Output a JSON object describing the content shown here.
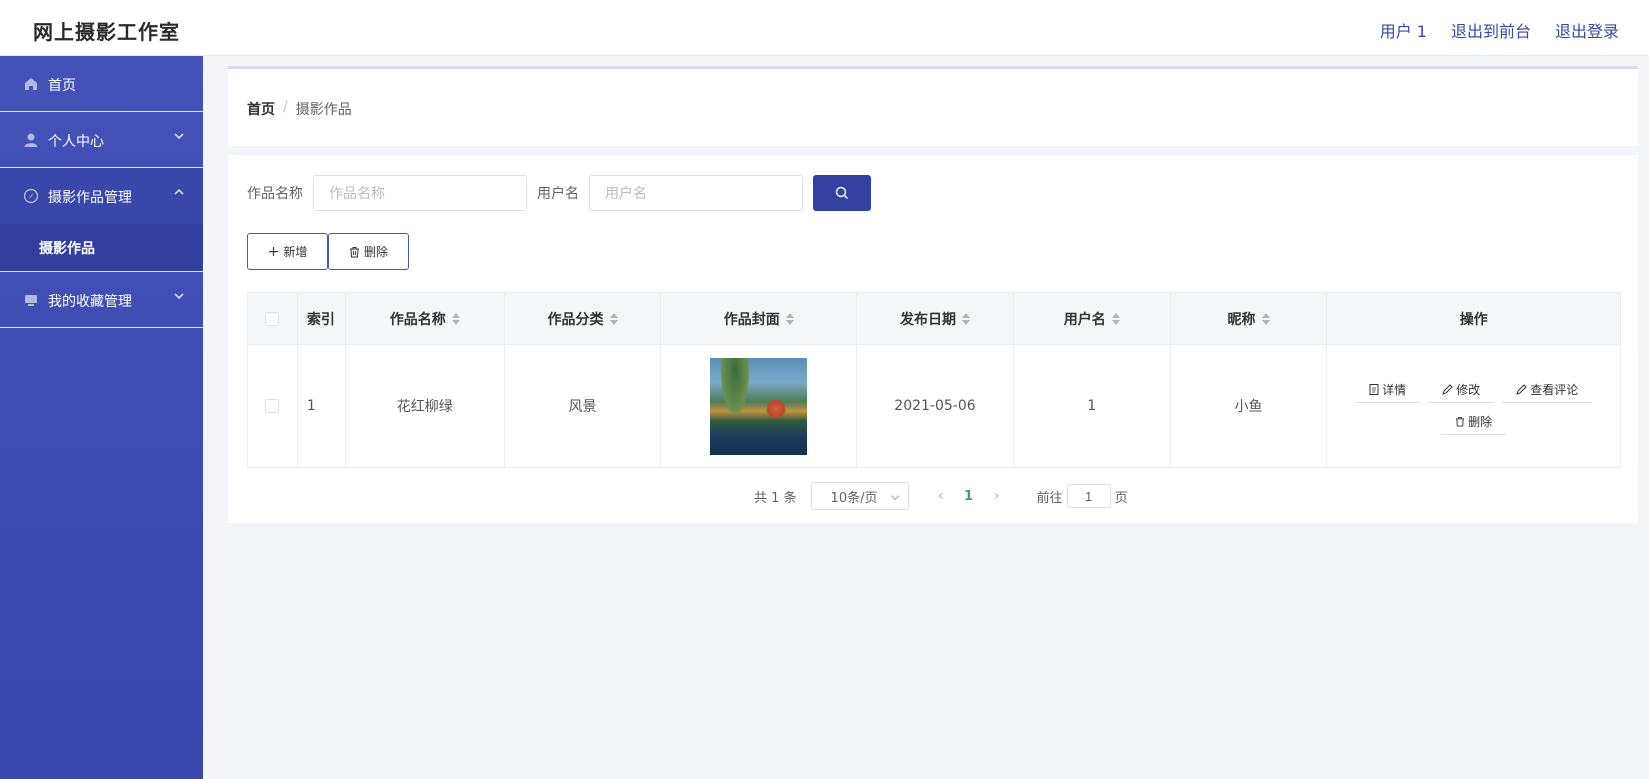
{
  "header": {
    "brand": "网上摄影工作室",
    "user": "用户 1",
    "back_to_front": "退出到前台",
    "logout": "退出登录"
  },
  "sidebar": {
    "items": [
      {
        "label": "首页",
        "icon": "home-icon"
      },
      {
        "label": "个人中心",
        "icon": "user-icon"
      },
      {
        "label": "摄影作品管理",
        "icon": "compass-icon",
        "open": true,
        "children": [
          {
            "label": "摄影作品"
          }
        ]
      },
      {
        "label": "我的收藏管理",
        "icon": "monitor-icon"
      }
    ]
  },
  "breadcrumb": {
    "home": "首页",
    "separator": "/",
    "current": "摄影作品"
  },
  "search": {
    "name_label": "作品名称",
    "name_placeholder": "作品名称",
    "user_label": "用户名",
    "user_placeholder": "用户名"
  },
  "actions": {
    "add": "新增",
    "delete": "删除"
  },
  "table": {
    "columns": [
      "索引",
      "作品名称",
      "作品分类",
      "作品封面",
      "发布日期",
      "用户名",
      "昵称",
      "操作"
    ],
    "rows": [
      {
        "index": "1",
        "name": "花红柳绿",
        "category": "风景",
        "date": "2021-05-06",
        "username": "1",
        "nickname": "小鱼",
        "ops": {
          "detail": "详情",
          "edit": "修改",
          "comments": "查看评论",
          "delete": "删除"
        }
      }
    ]
  },
  "pagination": {
    "total": "共 1 条",
    "page_size": "10条/页",
    "current_page": "1",
    "goto_label": "前往",
    "goto_value": "1",
    "page_suffix": "页"
  },
  "colors": {
    "sidebar": "#4452b8",
    "primary": "#3441a0",
    "active_page": "#3a9d8f"
  }
}
